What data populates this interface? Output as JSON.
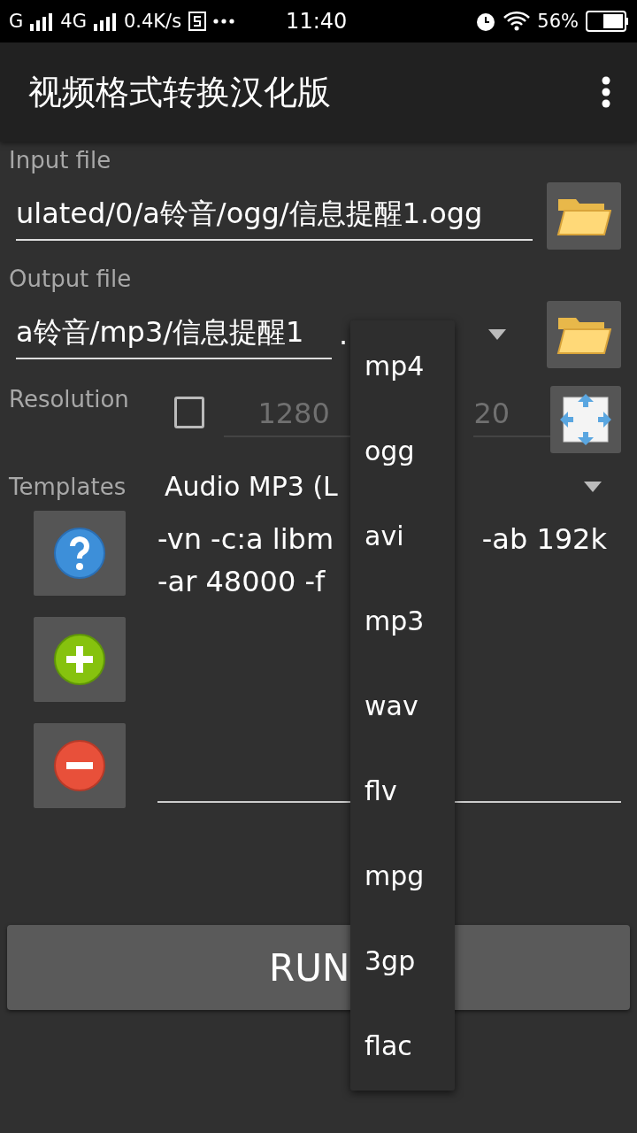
{
  "status_bar": {
    "carrier_1": "G",
    "carrier_2": "4G",
    "speed": "0.4K/s",
    "time": "11:40",
    "battery": "56%"
  },
  "app_bar": {
    "title": "视频格式转换汉化版"
  },
  "input_file": {
    "label": "Input file",
    "value": "ulated/0/a铃音/ogg/信息提醒1.ogg"
  },
  "output_file": {
    "label": "Output file",
    "value": "a铃音/mp3/信息提醒1",
    "separator": "."
  },
  "resolution": {
    "label": "Resolution",
    "checked": false,
    "width_placeholder": "1280",
    "height_placeholder": "20"
  },
  "templates": {
    "label": "Templates",
    "selected_template": "Audio MP3 (L",
    "command_fragments": [
      "-vn -c:a libm",
      "-ab 192k",
      "-ar 48000 -f"
    ]
  },
  "run_button": "RUN",
  "format_menu": {
    "items": [
      {
        "label": "mp4"
      },
      {
        "label": "ogg"
      },
      {
        "label": "avi"
      },
      {
        "label": "mp3"
      },
      {
        "label": "wav"
      },
      {
        "label": "flv"
      },
      {
        "label": "mpg"
      },
      {
        "label": "3gp"
      },
      {
        "label": "flac"
      }
    ]
  }
}
